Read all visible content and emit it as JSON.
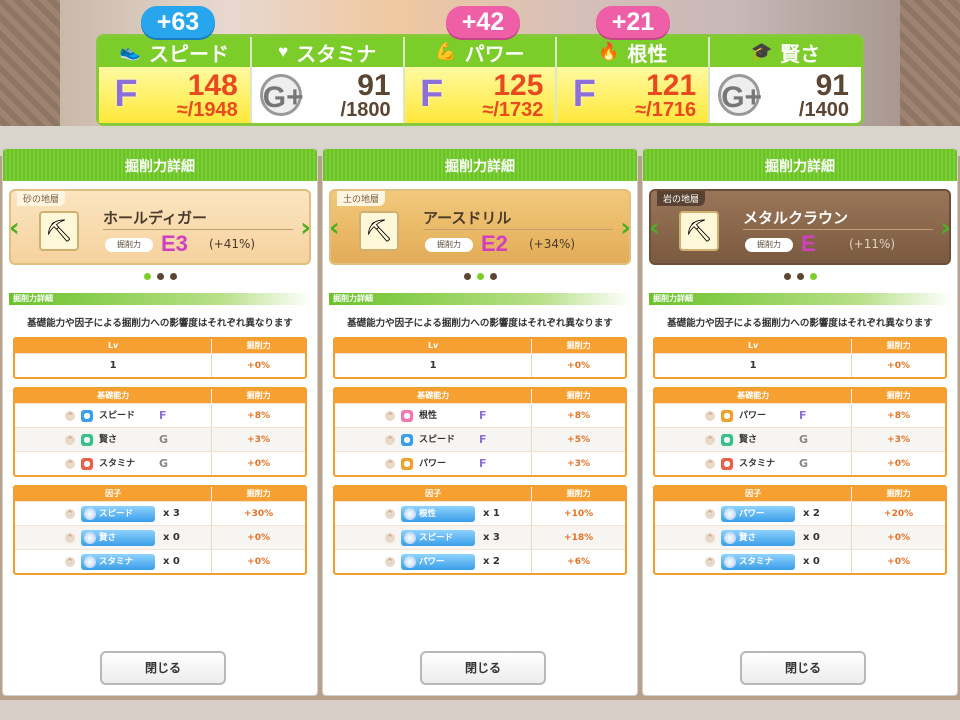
{
  "top": {
    "badges": [
      {
        "text": "+63",
        "color": "#27a6ee"
      },
      {
        "text": "+42",
        "color": "#ee5fa7"
      },
      {
        "text": "+21",
        "color": "#ee5fa7"
      }
    ],
    "stats": [
      {
        "name": "スピード",
        "icon": "shoe-icon",
        "grade": "F",
        "current": "148",
        "max": "≈/1948",
        "highlight": true
      },
      {
        "name": "スタミナ",
        "icon": "heart-icon",
        "grade": "G+",
        "current": "91",
        "max": "/1800",
        "highlight": false
      },
      {
        "name": "パワー",
        "icon": "muscle-icon",
        "grade": "F",
        "current": "125",
        "max": "≈/1732",
        "highlight": true
      },
      {
        "name": "根性",
        "icon": "flame-icon",
        "grade": "F",
        "current": "121",
        "max": "≈/1716",
        "highlight": true
      },
      {
        "name": "賢さ",
        "icon": "graduation-cap-icon",
        "grade": "G+",
        "current": "91",
        "max": "/1400",
        "highlight": false
      }
    ]
  },
  "panels": [
    {
      "title": "掘削力詳細",
      "stratum_type": "砂の地層",
      "stratum_style": "sand",
      "tool_name": "ホールディガー",
      "tool_icon": "hole-digger-icon",
      "power_label": "掘削力",
      "tool_grade": "E3",
      "tool_pct": "(+41%)",
      "active_dot": 0,
      "section_label": "掘削力詳細",
      "note": "基礎能力や因子による掘削力への影響度はそれぞれ異なります",
      "lv_table": {
        "h1": "Lv",
        "h2": "掘削力",
        "lv": "1",
        "power": "+0%"
      },
      "base_table": {
        "h1": "基礎能力",
        "h2": "掘削力",
        "rows": [
          {
            "name": "スピード",
            "icon_color": "#3a9ee8",
            "grade": "F",
            "g": false,
            "power": "+8%"
          },
          {
            "name": "賢さ",
            "icon_color": "#3ac08a",
            "grade": "G",
            "g": true,
            "power": "+3%"
          },
          {
            "name": "スタミナ",
            "icon_color": "#e8604a",
            "grade": "G",
            "g": true,
            "power": "+0%"
          }
        ]
      },
      "factor_table": {
        "h1": "因子",
        "h2": "掘削力",
        "rows": [
          {
            "name": "スピード",
            "count": "x 3",
            "power": "+30%"
          },
          {
            "name": "賢さ",
            "count": "x 0",
            "power": "+0%"
          },
          {
            "name": "スタミナ",
            "count": "x 0",
            "power": "+0%"
          }
        ]
      },
      "close_label": "閉じる"
    },
    {
      "title": "掘削力詳細",
      "stratum_type": "土の地層",
      "stratum_style": "soil",
      "tool_name": "アースドリル",
      "tool_icon": "earth-drill-icon",
      "power_label": "掘削力",
      "tool_grade": "E2",
      "tool_pct": "(+34%)",
      "active_dot": 1,
      "section_label": "掘削力詳細",
      "note": "基礎能力や因子による掘削力への影響度はそれぞれ異なります",
      "lv_table": {
        "h1": "Lv",
        "h2": "掘削力",
        "lv": "1",
        "power": "+0%"
      },
      "base_table": {
        "h1": "基礎能力",
        "h2": "掘削力",
        "rows": [
          {
            "name": "根性",
            "icon_color": "#f07ab0",
            "grade": "F",
            "g": false,
            "power": "+8%"
          },
          {
            "name": "スピード",
            "icon_color": "#3a9ee8",
            "grade": "F",
            "g": false,
            "power": "+5%"
          },
          {
            "name": "パワー",
            "icon_color": "#f0a030",
            "grade": "F",
            "g": false,
            "power": "+3%"
          }
        ]
      },
      "factor_table": {
        "h1": "因子",
        "h2": "掘削力",
        "rows": [
          {
            "name": "根性",
            "count": "x 1",
            "power": "+10%"
          },
          {
            "name": "スピード",
            "count": "x 3",
            "power": "+18%"
          },
          {
            "name": "パワー",
            "count": "x 2",
            "power": "+6%"
          }
        ]
      },
      "close_label": "閉じる"
    },
    {
      "title": "掘削力詳細",
      "stratum_type": "岩の地層",
      "stratum_style": "rock",
      "tool_name": "メタルクラウン",
      "tool_icon": "metal-crown-icon",
      "power_label": "掘削力",
      "tool_grade": "E",
      "tool_pct": "(+11%)",
      "active_dot": 2,
      "section_label": "掘削力詳細",
      "note": "基礎能力や因子による掘削力への影響度はそれぞれ異なります",
      "lv_table": {
        "h1": "Lv",
        "h2": "掘削力",
        "lv": "1",
        "power": "+0%"
      },
      "base_table": {
        "h1": "基礎能力",
        "h2": "掘削力",
        "rows": [
          {
            "name": "パワー",
            "icon_color": "#f0a030",
            "grade": "F",
            "g": false,
            "power": "+8%"
          },
          {
            "name": "賢さ",
            "icon_color": "#3ac08a",
            "grade": "G",
            "g": true,
            "power": "+3%"
          },
          {
            "name": "スタミナ",
            "icon_color": "#e8604a",
            "grade": "G",
            "g": true,
            "power": "+0%"
          }
        ]
      },
      "factor_table": {
        "h1": "因子",
        "h2": "掘削力",
        "rows": [
          {
            "name": "パワー",
            "count": "x 2",
            "power": "+20%"
          },
          {
            "name": "賢さ",
            "count": "x 0",
            "power": "+0%"
          },
          {
            "name": "スタミナ",
            "count": "x 0",
            "power": "+0%"
          }
        ]
      },
      "close_label": "閉じる"
    }
  ]
}
